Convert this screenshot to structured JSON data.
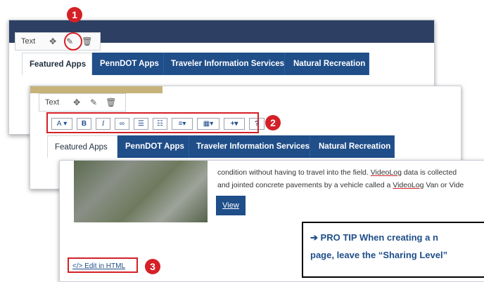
{
  "colors": {
    "accent_red": "#d42026",
    "tab_blue": "#1f4e89",
    "map_navy": "#2d3f63"
  },
  "panel1": {
    "text_tag": {
      "label": "Text",
      "icons": [
        "move-icon",
        "pencil-icon",
        "trash-icon"
      ]
    },
    "tabs": [
      "Featured Apps",
      "PennDOT Apps",
      "Traveler Information Services",
      "Natural Recreation"
    ]
  },
  "panel2": {
    "text_tag": {
      "label": "Text",
      "icons": [
        "move-icon",
        "pencil-icon",
        "trash-icon"
      ]
    },
    "toolbar": {
      "font": "A",
      "bold": "B",
      "italic": "I",
      "link": "∞",
      "help": "?"
    },
    "tabs": [
      "Featured Apps",
      "PennDOT Apps",
      "Traveler Information Services",
      "Natural Recreation"
    ]
  },
  "panel3": {
    "line1": "condition without having to travel into the field.",
    "videolog1": "VideoLog",
    "line1b": "data is collected",
    "line2": "and jointed concrete pavements by a vehicle called a",
    "videolog2": "VideoLog",
    "line2b": "Van or Vide",
    "view_button": "View",
    "edit_html": "</> Edit in HTML"
  },
  "markers": [
    "1",
    "2",
    "3"
  ],
  "tip": {
    "arrow": "➔",
    "label": "PRO TIP",
    "line1": "When creating a n",
    "line2": "page, leave the “Sharing Level”"
  }
}
